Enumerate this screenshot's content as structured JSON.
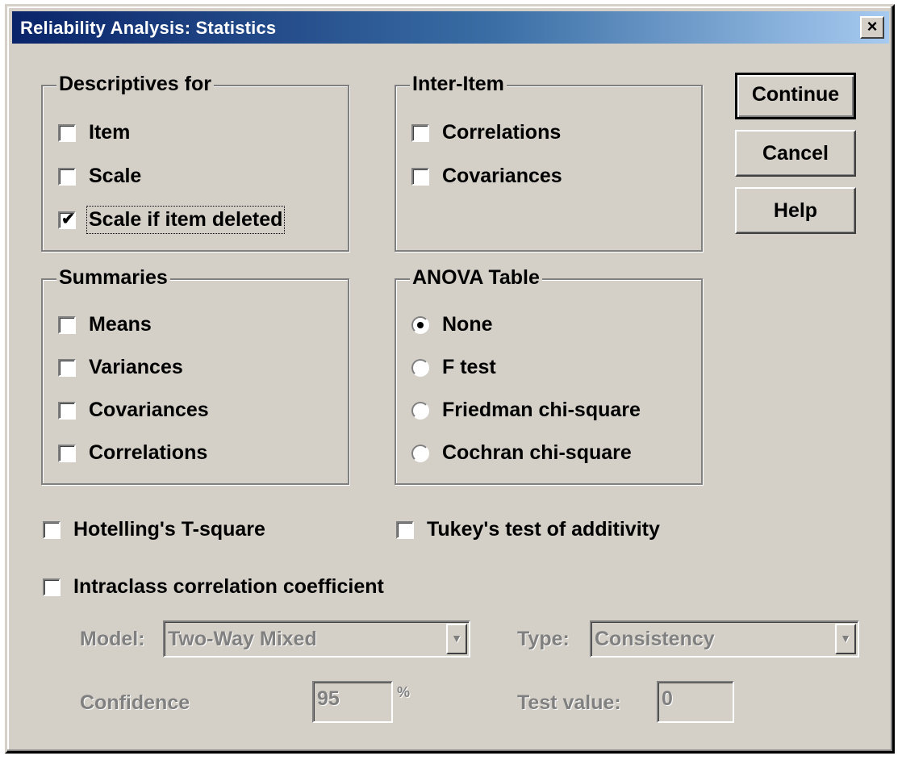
{
  "window": {
    "title": "Reliability Analysis: Statistics",
    "close_glyph": "×"
  },
  "buttons": {
    "continue": "Continue",
    "cancel": "Cancel",
    "help": "Help"
  },
  "descriptives": {
    "legend": "Descriptives for",
    "items": [
      {
        "label": "Item",
        "checked": false
      },
      {
        "label": "Scale",
        "checked": false
      },
      {
        "label": "Scale if item deleted",
        "checked": true
      }
    ]
  },
  "inter_item": {
    "legend": "Inter-Item",
    "items": [
      {
        "label": "Correlations",
        "checked": false
      },
      {
        "label": "Covariances",
        "checked": false
      }
    ]
  },
  "summaries": {
    "legend": "Summaries",
    "items": [
      {
        "label": "Means",
        "checked": false
      },
      {
        "label": "Variances",
        "checked": false
      },
      {
        "label": "Covariances",
        "checked": false
      },
      {
        "label": "Correlations",
        "checked": false
      }
    ]
  },
  "anova": {
    "legend": "ANOVA Table",
    "options": [
      {
        "label": "None",
        "selected": true
      },
      {
        "label": "F test",
        "selected": false
      },
      {
        "label": "Friedman chi-square",
        "selected": false
      },
      {
        "label": "Cochran chi-square",
        "selected": false
      }
    ]
  },
  "hotelling": {
    "label": "Hotelling's T-square",
    "checked": false
  },
  "tukey": {
    "label": "Tukey's test of additivity",
    "checked": false
  },
  "intraclass": {
    "label": "Intraclass correlation coefficient",
    "checked": false,
    "model_label": "Model:",
    "model_value": "Two-Way Mixed",
    "type_label": "Type:",
    "type_value": "Consistency",
    "confidence_label": "Confidence",
    "confidence_value": "95",
    "percent": "%",
    "test_value_label": "Test value:",
    "test_value": "0"
  },
  "icons": {
    "check": "check-icon",
    "dropdown": "chevron-down-icon",
    "close": "close-icon"
  }
}
